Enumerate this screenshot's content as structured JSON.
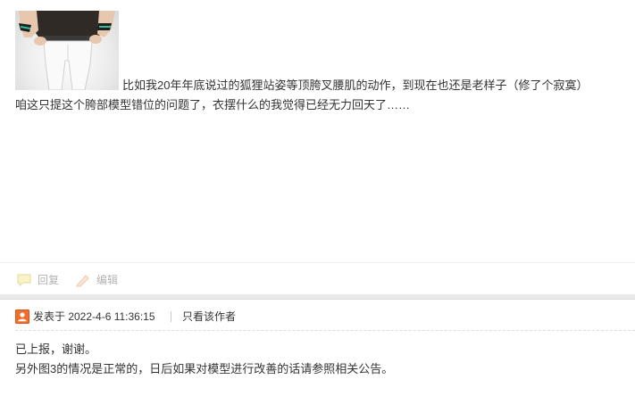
{
  "post1": {
    "body_line1": "比如我20年年底说过的狐狸站姿等顶胯叉腰肌的动作，到现在也还是老样子（修了个寂寞）",
    "body_line2": "咱这只提这个胯部模型错位的问题了，衣摆什么的我觉得已经无力回天了……",
    "actions": {
      "reply_label": "回复",
      "edit_label": "编辑"
    }
  },
  "post2": {
    "posted_at": "发表于 2022-4-6 11:36:15",
    "only_author_label": "只看该作者",
    "body_line1": "已上报，谢谢。",
    "body_line2": "另外图3的情况是正常的，日后如果对模型进行改善的话请参照相关公告。"
  },
  "icons": {
    "reply": "reply-icon",
    "edit": "edit-icon",
    "author": "author-icon"
  },
  "colors": {
    "text": "#333333",
    "muted": "#b3b3b3",
    "author_icon": "#f26c2a",
    "separator": "#e9e9e9"
  }
}
